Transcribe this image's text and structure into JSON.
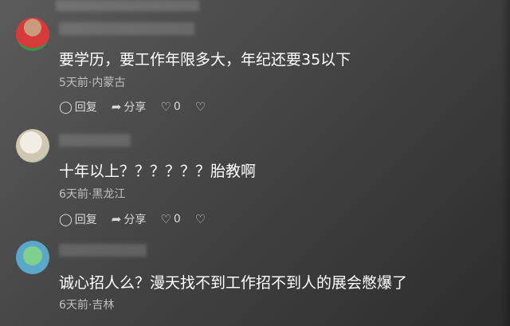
{
  "comments": [
    {
      "text": "要学历，要工作年限多大，年纪还要35以下",
      "meta": "5天前·内蒙古",
      "reply": "回复",
      "share": "分享",
      "likes": "0"
    },
    {
      "text": "十年以上？？？？？？胎教啊",
      "meta": "6天前·黑龙江",
      "reply": "回复",
      "share": "分享",
      "likes": "0"
    },
    {
      "text": "诚心招人么？漫天找不到工作招不到人的展会憋爆了",
      "meta": "6天前·吉林"
    }
  ],
  "icons": {
    "reply": "comment-bubble-icon",
    "share": "share-arrow-icon",
    "like": "heart-icon",
    "dislike": "broken-heart-icon"
  }
}
